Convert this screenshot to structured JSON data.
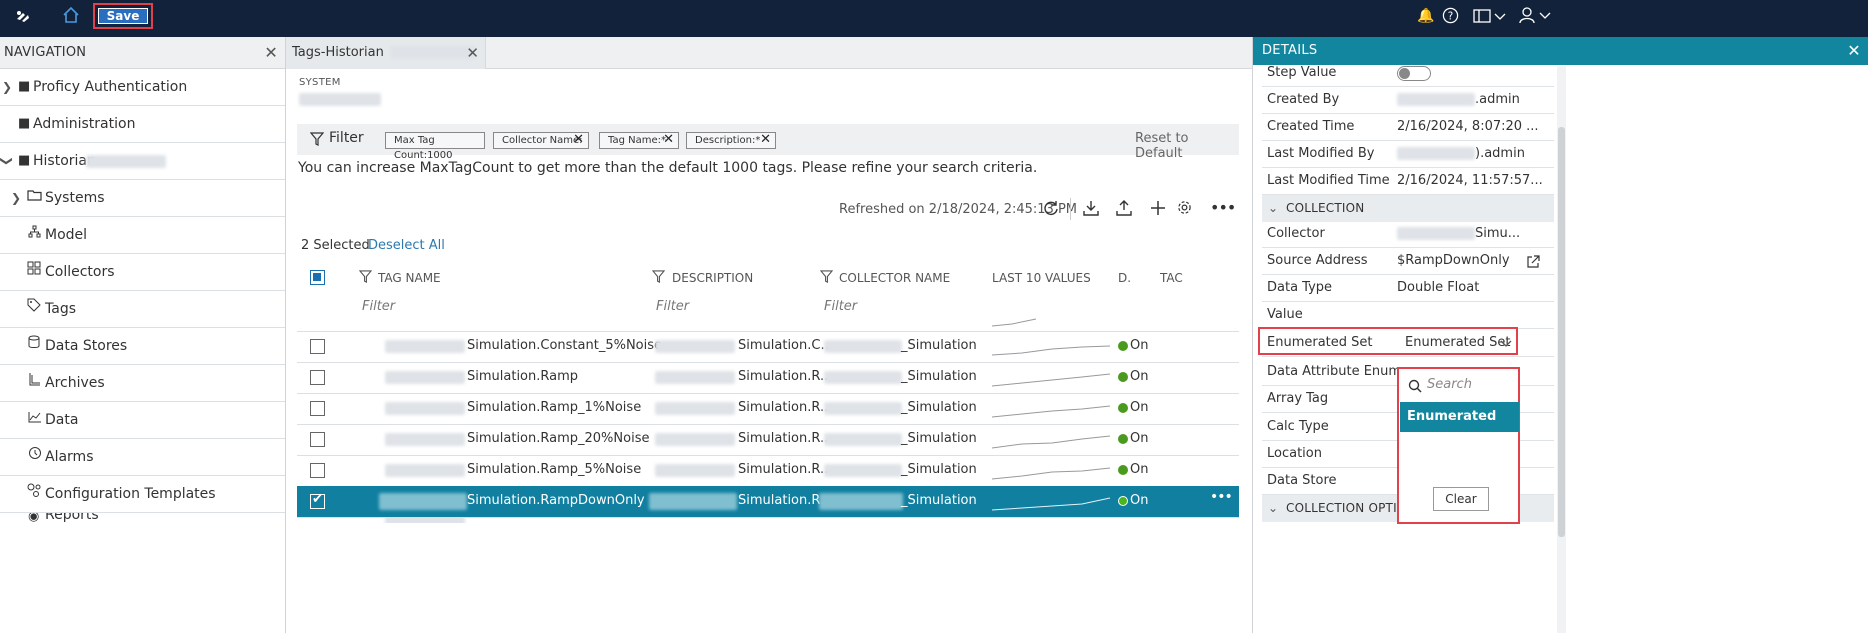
{
  "topbar": {
    "save_label": "Save"
  },
  "navigation": {
    "title": "NAVIGATION",
    "items": [
      {
        "label": "Proficy Authentication",
        "icon": "folder-icon"
      },
      {
        "label": "Administration",
        "icon": "folder-icon"
      },
      {
        "label": "Historian",
        "icon": "folder-icon"
      },
      {
        "label": "Systems",
        "icon": "folder-outline-icon"
      },
      {
        "label": "Model",
        "icon": "model-icon"
      },
      {
        "label": "Collectors",
        "icon": "collectors-icon"
      },
      {
        "label": "Tags",
        "icon": "tag-icon"
      },
      {
        "label": "Data Stores",
        "icon": "database-icon"
      },
      {
        "label": "Archives",
        "icon": "archive-icon"
      },
      {
        "label": "Data",
        "icon": "chart-icon"
      },
      {
        "label": "Alarms",
        "icon": "alarm-icon"
      },
      {
        "label": "Configuration Templates",
        "icon": "template-icon"
      },
      {
        "label": "Reports",
        "icon": "report-icon"
      }
    ]
  },
  "tab": {
    "label": "Tags-Historian"
  },
  "system_label": "SYSTEM",
  "filter": {
    "label": "Filter",
    "chips": [
      "Max Tag Count:1000",
      "Collector Name:",
      "Tag Name:*",
      "Description:*"
    ],
    "reset_label": "Reset to Default"
  },
  "message": "You can increase MaxTagCount to get more than the default 1000 tags. Please refine your search criteria.",
  "refreshed": "Refreshed on 2/18/2024, 2:45:13 PM",
  "selection": {
    "count_label": "2 Selected",
    "deselect_label": "Deselect All"
  },
  "table": {
    "columns": [
      "TAG NAME",
      "DESCRIPTION",
      "COLLECTOR NAME",
      "LAST 10 VALUES",
      "D.",
      "TAC"
    ],
    "filter_placeholder": "Filter",
    "rows": [
      {
        "tag": "Simulation.Constant_5%Noise",
        "desc": "Simulation.C...",
        "collector": "_Simulation",
        "status": "On",
        "selected": false
      },
      {
        "tag": "Simulation.Ramp",
        "desc": "Simulation.R...",
        "collector": "_Simulation",
        "status": "On",
        "selected": false
      },
      {
        "tag": "Simulation.Ramp_1%Noise",
        "desc": "Simulation.R...",
        "collector": "_Simulation",
        "status": "On",
        "selected": false
      },
      {
        "tag": "Simulation.Ramp_20%Noise",
        "desc": "Simulation.R...",
        "collector": "_Simulation",
        "status": "On",
        "selected": false
      },
      {
        "tag": "Simulation.Ramp_5%Noise",
        "desc": "Simulation.R...",
        "collector": "_Simulation",
        "status": "On",
        "selected": false
      },
      {
        "tag": "Simulation.RampDownOnly",
        "desc": "Simulation.R...",
        "collector": "_Simulation",
        "status": "On",
        "selected": true
      }
    ]
  },
  "details": {
    "title": "DETAILS",
    "step_value_label": "Step Value",
    "created_by_label": "Created By",
    "created_by_value": ".admin",
    "created_time_label": "Created Time",
    "created_time_value": "2/16/2024, 8:07:20 ...",
    "last_modified_by_label": "Last Modified By",
    "last_modified_by_value": ").admin",
    "last_modified_time_label": "Last Modified Time",
    "last_modified_time_value": "2/16/2024, 11:57:57...",
    "collection_section": "COLLECTION",
    "collector_label": "Collector",
    "collector_value": "Simu...",
    "source_address_label": "Source Address",
    "source_address_value": "$RampDownOnly",
    "data_type_label": "Data Type",
    "data_type_value": "Double Float",
    "value_label": "Value",
    "enum_set_label": "Enumerated Set",
    "enum_set_value": "Enumerated Set",
    "data_attr_enum_label": "Data Attribute Enum...",
    "array_tag_label": "Array Tag",
    "calc_type_label": "Calc Type",
    "location_label": "Location",
    "data_store_label": "Data Store",
    "collection_options_section": "COLLECTION OPTIO"
  },
  "dropdown": {
    "search_placeholder": "Search",
    "option": "Enumerated Set",
    "clear_label": "Clear"
  },
  "colors": {
    "topbar": "#12223a",
    "accent": "#13869f",
    "save_button": "#2a6ebf",
    "highlight_border": "#e0414b",
    "status_on": "#4a9a1f"
  }
}
